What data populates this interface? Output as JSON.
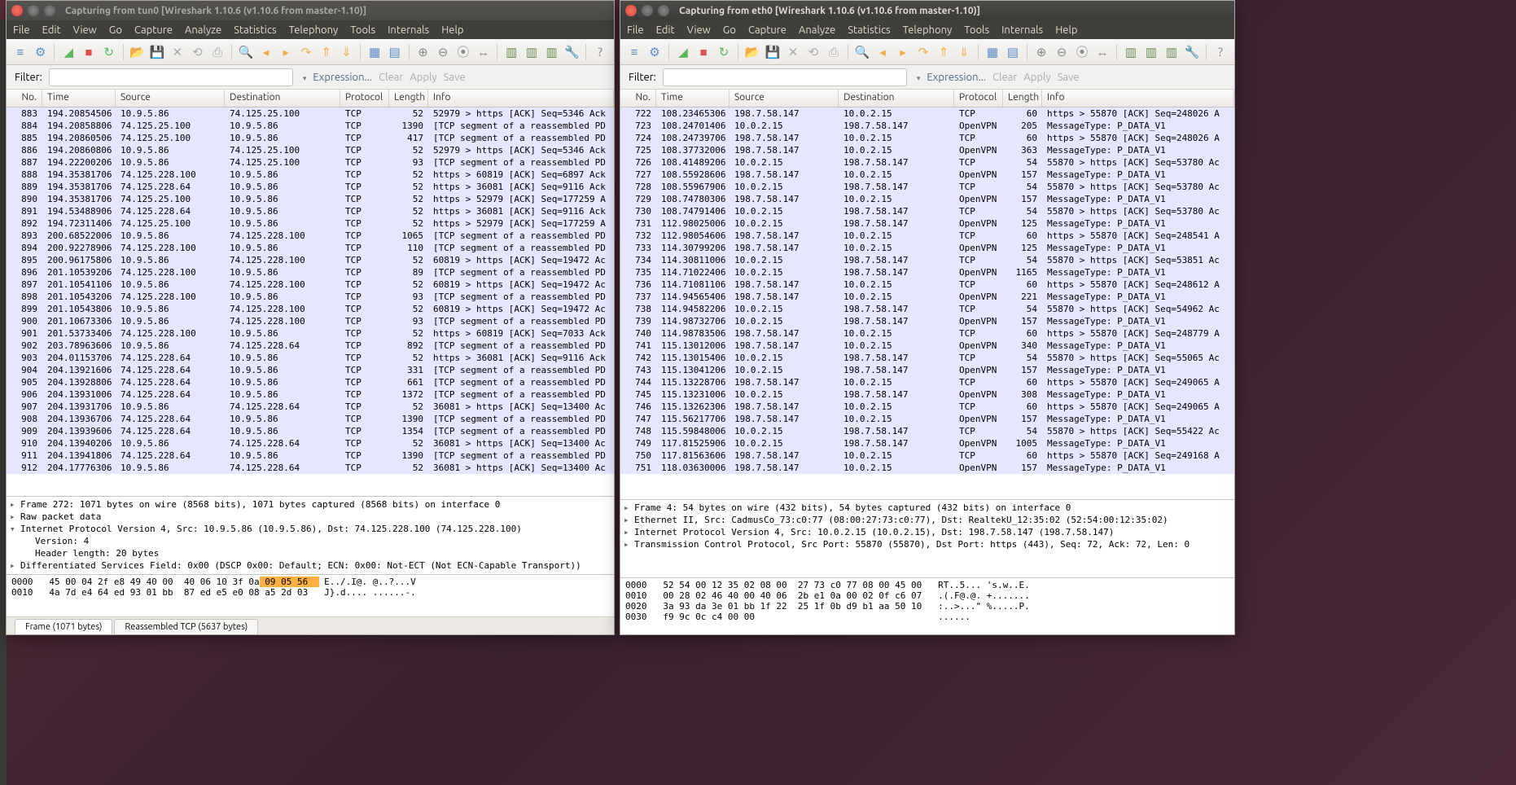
{
  "left": {
    "title": "Capturing from tun0    [Wireshark 1.10.6  (v1.10.6 from master-1.10)]",
    "menu": [
      "File",
      "Edit",
      "View",
      "Go",
      "Capture",
      "Analyze",
      "Statistics",
      "Telephony",
      "Tools",
      "Internals",
      "Help"
    ],
    "filter_label": "Filter:",
    "expression": "Expression...",
    "clear": "Clear",
    "apply": "Apply",
    "save": "Save",
    "columns": {
      "no": "No.",
      "time": "Time",
      "src": "Source",
      "dst": "Destination",
      "proto": "Protocol",
      "len": "Length",
      "info": "Info"
    },
    "rows": [
      {
        "no": "883",
        "time": "194.20854506",
        "src": "10.9.5.86",
        "dst": "74.125.25.100",
        "proto": "TCP",
        "len": "52",
        "info": "52979 > https [ACK] Seq=5346 Ack"
      },
      {
        "no": "884",
        "time": "194.20858806",
        "src": "74.125.25.100",
        "dst": "10.9.5.86",
        "proto": "TCP",
        "len": "1390",
        "info": "[TCP segment of a reassembled PD"
      },
      {
        "no": "885",
        "time": "194.20860506",
        "src": "74.125.25.100",
        "dst": "10.9.5.86",
        "proto": "TCP",
        "len": "417",
        "info": "[TCP segment of a reassembled PD"
      },
      {
        "no": "886",
        "time": "194.20860806",
        "src": "10.9.5.86",
        "dst": "74.125.25.100",
        "proto": "TCP",
        "len": "52",
        "info": "52979 > https [ACK] Seq=5346 Ack"
      },
      {
        "no": "887",
        "time": "194.22200206",
        "src": "10.9.5.86",
        "dst": "74.125.25.100",
        "proto": "TCP",
        "len": "93",
        "info": "[TCP segment of a reassembled PD"
      },
      {
        "no": "888",
        "time": "194.35381706",
        "src": "74.125.228.100",
        "dst": "10.9.5.86",
        "proto": "TCP",
        "len": "52",
        "info": "https > 60819 [ACK] Seq=6897 Ack"
      },
      {
        "no": "889",
        "time": "194.35381706",
        "src": "74.125.228.64",
        "dst": "10.9.5.86",
        "proto": "TCP",
        "len": "52",
        "info": "https > 36081 [ACK] Seq=9116 Ack"
      },
      {
        "no": "890",
        "time": "194.35381706",
        "src": "74.125.25.100",
        "dst": "10.9.5.86",
        "proto": "TCP",
        "len": "52",
        "info": "https > 52979 [ACK] Seq=177259 A"
      },
      {
        "no": "891",
        "time": "194.53488906",
        "src": "74.125.228.64",
        "dst": "10.9.5.86",
        "proto": "TCP",
        "len": "52",
        "info": "https > 36081 [ACK] Seq=9116 Ack"
      },
      {
        "no": "892",
        "time": "194.72311406",
        "src": "74.125.25.100",
        "dst": "10.9.5.86",
        "proto": "TCP",
        "len": "52",
        "info": "https > 52979 [ACK] Seq=177259 A"
      },
      {
        "no": "893",
        "time": "200.68522006",
        "src": "10.9.5.86",
        "dst": "74.125.228.100",
        "proto": "TCP",
        "len": "1065",
        "info": "[TCP segment of a reassembled PD"
      },
      {
        "no": "894",
        "time": "200.92278906",
        "src": "74.125.228.100",
        "dst": "10.9.5.86",
        "proto": "TCP",
        "len": "110",
        "info": "[TCP segment of a reassembled PD"
      },
      {
        "no": "895",
        "time": "200.96175806",
        "src": "10.9.5.86",
        "dst": "74.125.228.100",
        "proto": "TCP",
        "len": "52",
        "info": "60819 > https [ACK] Seq=19472 Ac"
      },
      {
        "no": "896",
        "time": "201.10539206",
        "src": "74.125.228.100",
        "dst": "10.9.5.86",
        "proto": "TCP",
        "len": "89",
        "info": "[TCP segment of a reassembled PD"
      },
      {
        "no": "897",
        "time": "201.10541106",
        "src": "10.9.5.86",
        "dst": "74.125.228.100",
        "proto": "TCP",
        "len": "52",
        "info": "60819 > https [ACK] Seq=19472 Ac"
      },
      {
        "no": "898",
        "time": "201.10543206",
        "src": "74.125.228.100",
        "dst": "10.9.5.86",
        "proto": "TCP",
        "len": "93",
        "info": "[TCP segment of a reassembled PD"
      },
      {
        "no": "899",
        "time": "201.10543806",
        "src": "10.9.5.86",
        "dst": "74.125.228.100",
        "proto": "TCP",
        "len": "52",
        "info": "60819 > https [ACK] Seq=19472 Ac"
      },
      {
        "no": "900",
        "time": "201.10673306",
        "src": "10.9.5.86",
        "dst": "74.125.228.100",
        "proto": "TCP",
        "len": "93",
        "info": "[TCP segment of a reassembled PD"
      },
      {
        "no": "901",
        "time": "201.53733406",
        "src": "74.125.228.100",
        "dst": "10.9.5.86",
        "proto": "TCP",
        "len": "52",
        "info": "https > 60819 [ACK] Seq=7033 Ack"
      },
      {
        "no": "902",
        "time": "203.78963606",
        "src": "10.9.5.86",
        "dst": "74.125.228.64",
        "proto": "TCP",
        "len": "892",
        "info": "[TCP segment of a reassembled PD"
      },
      {
        "no": "903",
        "time": "204.01153706",
        "src": "74.125.228.64",
        "dst": "10.9.5.86",
        "proto": "TCP",
        "len": "52",
        "info": "https > 36081 [ACK] Seq=9116 Ack"
      },
      {
        "no": "904",
        "time": "204.13921606",
        "src": "74.125.228.64",
        "dst": "10.9.5.86",
        "proto": "TCP",
        "len": "331",
        "info": "[TCP segment of a reassembled PD"
      },
      {
        "no": "905",
        "time": "204.13928806",
        "src": "74.125.228.64",
        "dst": "10.9.5.86",
        "proto": "TCP",
        "len": "661",
        "info": "[TCP segment of a reassembled PD"
      },
      {
        "no": "906",
        "time": "204.13931006",
        "src": "74.125.228.64",
        "dst": "10.9.5.86",
        "proto": "TCP",
        "len": "1372",
        "info": "[TCP segment of a reassembled PD"
      },
      {
        "no": "907",
        "time": "204.13931706",
        "src": "10.9.5.86",
        "dst": "74.125.228.64",
        "proto": "TCP",
        "len": "52",
        "info": "36081 > https [ACK] Seq=13400 Ac"
      },
      {
        "no": "908",
        "time": "204.13936706",
        "src": "74.125.228.64",
        "dst": "10.9.5.86",
        "proto": "TCP",
        "len": "1390",
        "info": "[TCP segment of a reassembled PD"
      },
      {
        "no": "909",
        "time": "204.13939606",
        "src": "74.125.228.64",
        "dst": "10.9.5.86",
        "proto": "TCP",
        "len": "1354",
        "info": "[TCP segment of a reassembled PD"
      },
      {
        "no": "910",
        "time": "204.13940206",
        "src": "10.9.5.86",
        "dst": "74.125.228.64",
        "proto": "TCP",
        "len": "52",
        "info": "36081 > https [ACK] Seq=13400 Ac"
      },
      {
        "no": "911",
        "time": "204.13941806",
        "src": "74.125.228.64",
        "dst": "10.9.5.86",
        "proto": "TCP",
        "len": "1390",
        "info": "[TCP segment of a reassembled PD"
      },
      {
        "no": "912",
        "time": "204.17776306",
        "src": "10.9.5.86",
        "dst": "74.125.228.64",
        "proto": "TCP",
        "len": "52",
        "info": "36081 > https [ACK] Seq=13400 Ac"
      }
    ],
    "details": [
      {
        "open": false,
        "child": false,
        "t": "Frame 272: 1071 bytes on wire (8568 bits), 1071 bytes captured (8568 bits) on interface 0"
      },
      {
        "open": false,
        "child": false,
        "t": "Raw packet data"
      },
      {
        "open": true,
        "child": false,
        "t": "Internet Protocol Version 4, Src: 10.9.5.86 (10.9.5.86), Dst: 74.125.228.100 (74.125.228.100)"
      },
      {
        "open": false,
        "child": true,
        "t": "Version: 4"
      },
      {
        "open": false,
        "child": true,
        "t": "Header length: 20 bytes"
      },
      {
        "open": false,
        "child": false,
        "t": "Differentiated Services Field: 0x00 (DSCP 0x00: Default; ECN: 0x00: Not-ECT (Not ECN-Capable Transport))"
      }
    ],
    "hex": [
      "0000   45 00 04 2f e8 49 40 00  40 06 10 3f 0a 09 05 56   E../.I@. @..?...V",
      "0010   4a 7d e4 64 ed 93 01 bb  87 ed e5 e0 08 a5 2d 03   J}.d.... ......-."
    ],
    "hex_hl_start": 12,
    "tabs": {
      "frame": "Frame (1071 bytes)",
      "reasm": "Reassembled TCP (5637 bytes)"
    }
  },
  "right": {
    "title": "Capturing from eth0    [Wireshark 1.10.6  (v1.10.6 from master-1.10)]",
    "rows": [
      {
        "no": "722",
        "time": "108.23465306",
        "src": "198.7.58.147",
        "dst": "10.0.2.15",
        "proto": "TCP",
        "len": "60",
        "info": "https > 55870 [ACK] Seq=248026 A"
      },
      {
        "no": "723",
        "time": "108.24701406",
        "src": "10.0.2.15",
        "dst": "198.7.58.147",
        "proto": "OpenVPN",
        "len": "205",
        "info": "MessageType: P_DATA_V1"
      },
      {
        "no": "724",
        "time": "108.24739706",
        "src": "198.7.58.147",
        "dst": "10.0.2.15",
        "proto": "TCP",
        "len": "60",
        "info": "https > 55870 [ACK] Seq=248026 A"
      },
      {
        "no": "725",
        "time": "108.37732006",
        "src": "198.7.58.147",
        "dst": "10.0.2.15",
        "proto": "OpenVPN",
        "len": "363",
        "info": "MessageType: P_DATA_V1"
      },
      {
        "no": "726",
        "time": "108.41489206",
        "src": "10.0.2.15",
        "dst": "198.7.58.147",
        "proto": "TCP",
        "len": "54",
        "info": "55870 > https [ACK] Seq=53780 Ac"
      },
      {
        "no": "727",
        "time": "108.55928606",
        "src": "198.7.58.147",
        "dst": "10.0.2.15",
        "proto": "OpenVPN",
        "len": "157",
        "info": "MessageType: P_DATA_V1"
      },
      {
        "no": "728",
        "time": "108.55967906",
        "src": "10.0.2.15",
        "dst": "198.7.58.147",
        "proto": "TCP",
        "len": "54",
        "info": "55870 > https [ACK] Seq=53780 Ac"
      },
      {
        "no": "729",
        "time": "108.74780306",
        "src": "198.7.58.147",
        "dst": "10.0.2.15",
        "proto": "OpenVPN",
        "len": "157",
        "info": "MessageType: P_DATA_V1"
      },
      {
        "no": "730",
        "time": "108.74791406",
        "src": "10.0.2.15",
        "dst": "198.7.58.147",
        "proto": "TCP",
        "len": "54",
        "info": "55870 > https [ACK] Seq=53780 Ac"
      },
      {
        "no": "731",
        "time": "112.98025006",
        "src": "10.0.2.15",
        "dst": "198.7.58.147",
        "proto": "OpenVPN",
        "len": "125",
        "info": "MessageType: P_DATA_V1"
      },
      {
        "no": "732",
        "time": "112.98054606",
        "src": "198.7.58.147",
        "dst": "10.0.2.15",
        "proto": "TCP",
        "len": "60",
        "info": "https > 55870 [ACK] Seq=248541 A"
      },
      {
        "no": "733",
        "time": "114.30799206",
        "src": "198.7.58.147",
        "dst": "10.0.2.15",
        "proto": "OpenVPN",
        "len": "125",
        "info": "MessageType: P_DATA_V1"
      },
      {
        "no": "734",
        "time": "114.30811006",
        "src": "10.0.2.15",
        "dst": "198.7.58.147",
        "proto": "TCP",
        "len": "54",
        "info": "55870 > https [ACK] Seq=53851 Ac"
      },
      {
        "no": "735",
        "time": "114.71022406",
        "src": "10.0.2.15",
        "dst": "198.7.58.147",
        "proto": "OpenVPN",
        "len": "1165",
        "info": "MessageType: P_DATA_V1"
      },
      {
        "no": "736",
        "time": "114.71081106",
        "src": "198.7.58.147",
        "dst": "10.0.2.15",
        "proto": "TCP",
        "len": "60",
        "info": "https > 55870 [ACK] Seq=248612 A"
      },
      {
        "no": "737",
        "time": "114.94565406",
        "src": "198.7.58.147",
        "dst": "10.0.2.15",
        "proto": "OpenVPN",
        "len": "221",
        "info": "MessageType: P_DATA_V1"
      },
      {
        "no": "738",
        "time": "114.94582206",
        "src": "10.0.2.15",
        "dst": "198.7.58.147",
        "proto": "TCP",
        "len": "54",
        "info": "55870 > https [ACK] Seq=54962 Ac"
      },
      {
        "no": "739",
        "time": "114.98732706",
        "src": "10.0.2.15",
        "dst": "198.7.58.147",
        "proto": "OpenVPN",
        "len": "157",
        "info": "MessageType: P_DATA_V1"
      },
      {
        "no": "740",
        "time": "114.98783506",
        "src": "198.7.58.147",
        "dst": "10.0.2.15",
        "proto": "TCP",
        "len": "60",
        "info": "https > 55870 [ACK] Seq=248779 A"
      },
      {
        "no": "741",
        "time": "115.13012006",
        "src": "198.7.58.147",
        "dst": "10.0.2.15",
        "proto": "OpenVPN",
        "len": "340",
        "info": "MessageType: P_DATA_V1"
      },
      {
        "no": "742",
        "time": "115.13015406",
        "src": "10.0.2.15",
        "dst": "198.7.58.147",
        "proto": "TCP",
        "len": "54",
        "info": "55870 > https [ACK] Seq=55065 Ac"
      },
      {
        "no": "743",
        "time": "115.13041206",
        "src": "10.0.2.15",
        "dst": "198.7.58.147",
        "proto": "OpenVPN",
        "len": "157",
        "info": "MessageType: P_DATA_V1"
      },
      {
        "no": "744",
        "time": "115.13228706",
        "src": "198.7.58.147",
        "dst": "10.0.2.15",
        "proto": "TCP",
        "len": "60",
        "info": "https > 55870 [ACK] Seq=249065 A"
      },
      {
        "no": "745",
        "time": "115.13231006",
        "src": "10.0.2.15",
        "dst": "198.7.58.147",
        "proto": "OpenVPN",
        "len": "308",
        "info": "MessageType: P_DATA_V1"
      },
      {
        "no": "746",
        "time": "115.13262306",
        "src": "198.7.58.147",
        "dst": "10.0.2.15",
        "proto": "TCP",
        "len": "60",
        "info": "https > 55870 [ACK] Seq=249065 A"
      },
      {
        "no": "747",
        "time": "115.56217706",
        "src": "198.7.58.147",
        "dst": "10.0.2.15",
        "proto": "OpenVPN",
        "len": "157",
        "info": "MessageType: P_DATA_V1"
      },
      {
        "no": "748",
        "time": "115.59848006",
        "src": "10.0.2.15",
        "dst": "198.7.58.147",
        "proto": "TCP",
        "len": "54",
        "info": "55870 > https [ACK] Seq=55422 Ac"
      },
      {
        "no": "749",
        "time": "117.81525906",
        "src": "10.0.2.15",
        "dst": "198.7.58.147",
        "proto": "OpenVPN",
        "len": "1005",
        "info": "MessageType: P_DATA_V1"
      },
      {
        "no": "750",
        "time": "117.81563606",
        "src": "198.7.58.147",
        "dst": "10.0.2.15",
        "proto": "TCP",
        "len": "60",
        "info": "https > 55870 [ACK] Seq=249168 A"
      },
      {
        "no": "751",
        "time": "118.03630006",
        "src": "198.7.58.147",
        "dst": "10.0.2.15",
        "proto": "OpenVPN",
        "len": "157",
        "info": "MessageType: P_DATA_V1"
      }
    ],
    "details": [
      {
        "open": false,
        "child": false,
        "t": "Frame 4: 54 bytes on wire (432 bits), 54 bytes captured (432 bits) on interface 0"
      },
      {
        "open": false,
        "child": false,
        "t": "Ethernet II, Src: CadmusCo_73:c0:77 (08:00:27:73:c0:77), Dst: RealtekU_12:35:02 (52:54:00:12:35:02)"
      },
      {
        "open": false,
        "child": false,
        "t": "Internet Protocol Version 4, Src: 10.0.2.15 (10.0.2.15), Dst: 198.7.58.147 (198.7.58.147)"
      },
      {
        "open": false,
        "child": false,
        "t": "Transmission Control Protocol, Src Port: 55870 (55870), Dst Port: https (443), Seq: 72, Ack: 72, Len: 0"
      }
    ],
    "hex": [
      "0000   52 54 00 12 35 02 08 00  27 73 c0 77 08 00 45 00   RT..5... 's.w..E.",
      "0010   00 28 02 46 40 00 40 06  2b e1 0a 00 02 0f c6 07   .(.F@.@. +.......",
      "0020   3a 93 da 3e 01 bb 1f 22  25 1f 0b d9 b1 aa 50 10   :..>...\" %.....P.",
      "0030   f9 9c 0c c4 00 00                                  ......"
    ]
  },
  "toolbar_icons": [
    {
      "name": "list-capture-icon",
      "g": "≡",
      "c": "#5a8cc4"
    },
    {
      "name": "options-icon",
      "g": "⚙",
      "c": "#5a8cc4"
    },
    {
      "sep": true
    },
    {
      "name": "start-icon",
      "g": "◢",
      "c": "#5cb85c"
    },
    {
      "name": "stop-icon",
      "g": "■",
      "c": "#d9534f"
    },
    {
      "name": "restart-icon",
      "g": "↻",
      "c": "#5cb85c"
    },
    {
      "sep": true
    },
    {
      "name": "open-icon",
      "g": "📂",
      "c": "#d99547"
    },
    {
      "name": "save-icon",
      "g": "💾",
      "c": "#888"
    },
    {
      "name": "close-icon",
      "g": "✕",
      "c": "#aaa"
    },
    {
      "name": "reload-icon",
      "g": "⟲",
      "c": "#aaa"
    },
    {
      "name": "print-icon",
      "g": "⎙",
      "c": "#aaa"
    },
    {
      "sep": true
    },
    {
      "name": "find-icon",
      "g": "🔍",
      "c": "#4a6a8a"
    },
    {
      "name": "prev-icon",
      "g": "◂",
      "c": "#f0ad4e"
    },
    {
      "name": "next-icon",
      "g": "▸",
      "c": "#f0ad4e"
    },
    {
      "name": "jump-icon",
      "g": "↷",
      "c": "#f0ad4e"
    },
    {
      "name": "goto-first-icon",
      "g": "⇑",
      "c": "#f0ad4e"
    },
    {
      "name": "goto-last-icon",
      "g": "⇓",
      "c": "#f0ad4e"
    },
    {
      "sep": true
    },
    {
      "name": "colorize-icon",
      "g": "▦",
      "c": "#5a8cc4"
    },
    {
      "name": "autoscroll-icon",
      "g": "▤",
      "c": "#5a8cc4"
    },
    {
      "sep": true
    },
    {
      "name": "zoom-in-icon",
      "g": "⊕",
      "c": "#888"
    },
    {
      "name": "zoom-out-icon",
      "g": "⊖",
      "c": "#888"
    },
    {
      "name": "zoom-reset-icon",
      "g": "⦿",
      "c": "#888"
    },
    {
      "name": "resize-cols-icon",
      "g": "↔",
      "c": "#888"
    },
    {
      "sep": true
    },
    {
      "name": "capture-filters-icon",
      "g": "▥",
      "c": "#6a8a50"
    },
    {
      "name": "display-filters-icon",
      "g": "▥",
      "c": "#6a8a50"
    },
    {
      "name": "coloring-rules-icon",
      "g": "▥",
      "c": "#6a8a50"
    },
    {
      "name": "prefs-icon",
      "g": "🔧",
      "c": "#888"
    },
    {
      "sep": true
    },
    {
      "name": "help-icon",
      "g": "?",
      "c": "#888"
    }
  ]
}
